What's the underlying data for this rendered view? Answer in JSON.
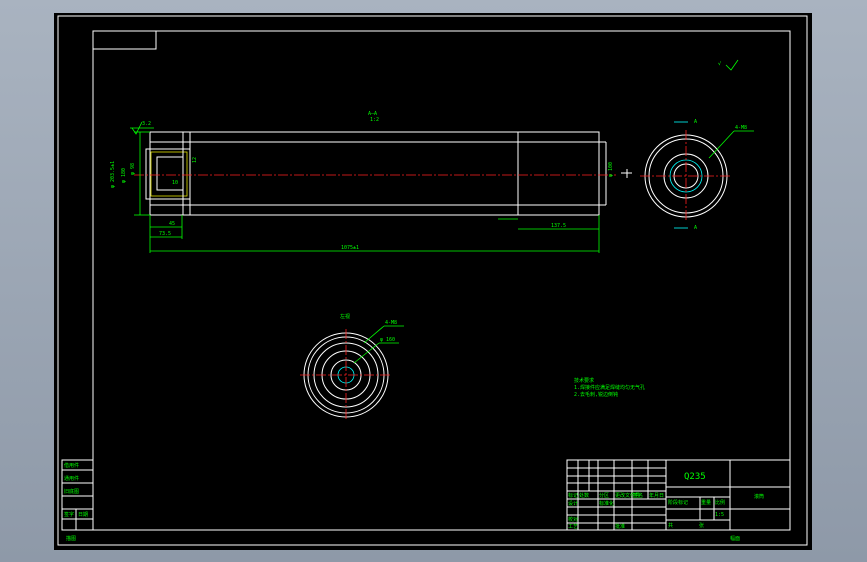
{
  "drawing": {
    "material": "Q235",
    "section_label": "A—A",
    "section_scale": "1:2",
    "view_label": "A",
    "view_label_2": "A",
    "left_view_label": "左视",
    "roughness_symbol": "√",
    "roughness_value": "3.2",
    "dim_overall": "1075±1",
    "dim_right_end": "137.5",
    "dim_45": "45",
    "dim_73": "73.5",
    "dim_10": "10",
    "dim_d_outer": "φ 190",
    "dim_d_bore": "φ 100",
    "dim_d_hole": "φ 98",
    "dim_d_groove": "φ 180",
    "dim_d_left": "φ 203.5±1",
    "dim_12": "12",
    "dim_chamfer": "4-M8",
    "circle_note_1": "4-M8",
    "circle_note_2": "φ 160",
    "circle_note_3": "4-M8深",
    "tech_title": "技术要求",
    "tech_line_1": "1.焊接件应满足焊缝均匀无气孔",
    "tech_line_2": "2.去毛刺,锐边倒钝"
  },
  "title_block": {
    "designer_label": "设计",
    "checker_label": "校对",
    "std_label": "标准化",
    "approve_label": "批准",
    "process_label": "工艺",
    "date_label": "日期",
    "weight_label": "重量",
    "scale_label": "比例",
    "scale_value": "1:5",
    "sheet_label": "共",
    "sheet_label_2": "张",
    "part_name": "滚筒",
    "code_cols": [
      "标记",
      "处数",
      "分区",
      "更改文件号",
      "签名",
      "年月日"
    ],
    "stage_label": "阶段标记"
  },
  "side_stamps": [
    "借用件",
    "通用件",
    "旧底图",
    "签字",
    "日期"
  ],
  "bottom_stamp": "描图",
  "bottom_stamp_2": "幅面"
}
